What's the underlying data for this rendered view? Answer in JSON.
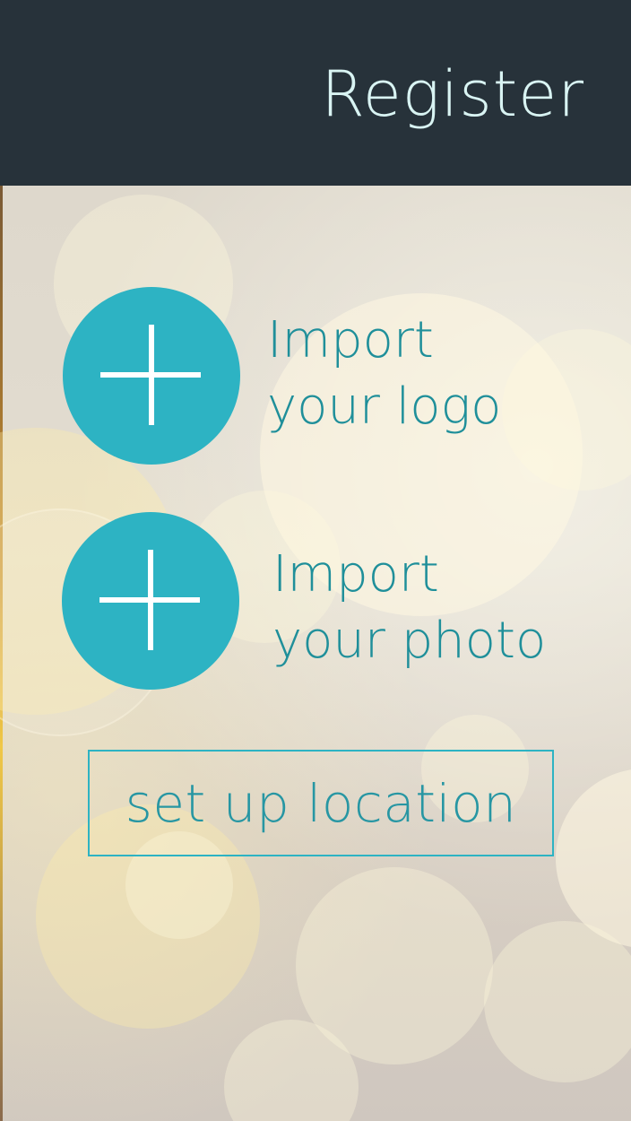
{
  "header": {
    "title": "Register",
    "background_color": "#27323a"
  },
  "actions": {
    "import_logo": {
      "icon": "plus-icon",
      "line1": "Import",
      "line2": "your logo"
    },
    "import_photo": {
      "icon": "plus-icon",
      "line1": "Import",
      "line2": "your photo"
    },
    "set_up_location": {
      "label": "set up location"
    }
  },
  "colors": {
    "accent": "#2db3c3",
    "text_accent": "#1f8f9a"
  }
}
